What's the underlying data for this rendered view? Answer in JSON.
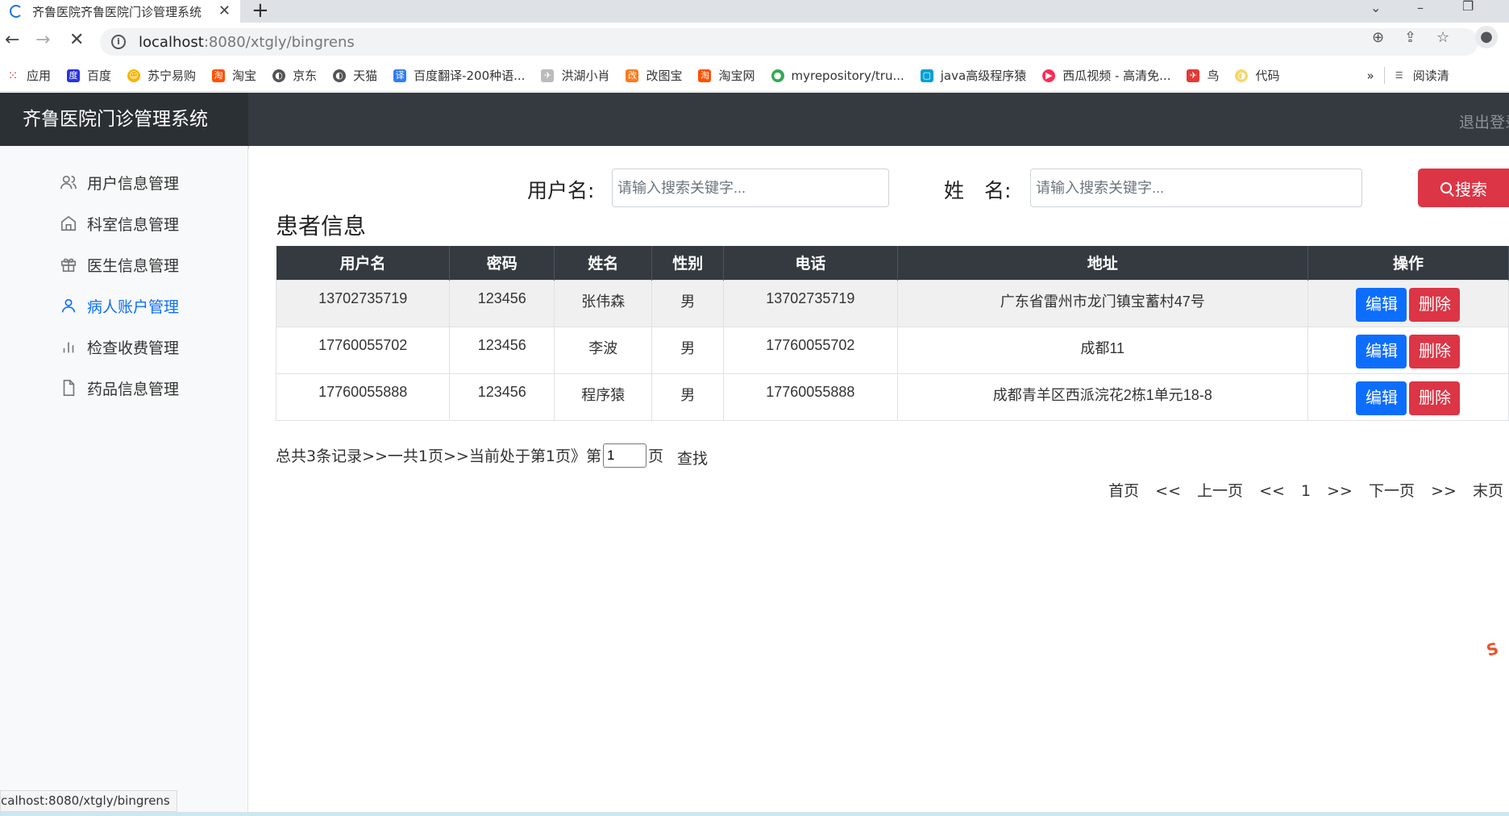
{
  "browser": {
    "tab_title": "齐鲁医院齐鲁医院门诊管理系统",
    "url_host": "localhost",
    "url_rest": ":8080/xtgly/bingrens",
    "status_url": "calhost:8080/xtgly/bingrens",
    "bookmarks": [
      {
        "label": "应用",
        "icon": "apps-grid-icon",
        "color": "#e53935"
      },
      {
        "label": "百度",
        "icon": "baidu-paw-icon",
        "color": "#2932e1"
      },
      {
        "label": "苏宁易购",
        "icon": "suning-icon",
        "color": "#f7b500"
      },
      {
        "label": "淘宝",
        "icon": "taobao-icon",
        "color": "#ff5000"
      },
      {
        "label": "京东",
        "icon": "globe-icon",
        "color": "#555555"
      },
      {
        "label": "天猫",
        "icon": "globe-icon",
        "color": "#555555"
      },
      {
        "label": "百度翻译-200种语...",
        "icon": "baidu-translate-icon",
        "color": "#2f7ef5"
      },
      {
        "label": "洪湖小肖",
        "icon": "bird-icon",
        "color": "#999999"
      },
      {
        "label": "改图宝",
        "icon": "gaitubao-icon",
        "color": "#ff7a1a"
      },
      {
        "label": "淘宝网",
        "icon": "taobao-icon",
        "color": "#ff5000"
      },
      {
        "label": "myrepository/tru...",
        "icon": "chrome-icon",
        "color": "#34a853"
      },
      {
        "label": "java高级程序猿",
        "icon": "bilibili-icon",
        "color": "#00a1d6"
      },
      {
        "label": "西瓜视频 - 高清免...",
        "icon": "xigua-icon",
        "color": "#fe2c55"
      },
      {
        "label": "鸟",
        "icon": "bird-icon",
        "color": "#e53935"
      },
      {
        "label": "代码",
        "icon": "moon-icon",
        "color": "#f5d76e"
      }
    ],
    "reading_list": "阅读清"
  },
  "app": {
    "brand": "齐鲁医院门诊管理系统",
    "logout": "退出登录"
  },
  "sidebar": {
    "items": [
      {
        "label": "用户信息管理",
        "icon": "users-icon",
        "active": false
      },
      {
        "label": "科室信息管理",
        "icon": "home-icon",
        "active": false
      },
      {
        "label": "医生信息管理",
        "icon": "gift-icon",
        "active": false
      },
      {
        "label": "病人账户管理",
        "icon": "person-icon",
        "active": true
      },
      {
        "label": "检查收费管理",
        "icon": "bar-chart-icon",
        "active": false
      },
      {
        "label": "药品信息管理",
        "icon": "file-icon",
        "active": false
      }
    ]
  },
  "search": {
    "username_label": "用户名:",
    "name_label": "姓　名:",
    "placeholder": "请输入搜索关键字...",
    "button": "搜索"
  },
  "table": {
    "title": "患者信息",
    "headers": [
      "用户名",
      "密码",
      "姓名",
      "性别",
      "电话",
      "地址",
      "操作"
    ],
    "rows": [
      {
        "username": "13702735719",
        "password": "123456",
        "name": "张伟森",
        "gender": "男",
        "phone": "13702735719",
        "address": "广东省雷州市龙门镇宝蓄村47号"
      },
      {
        "username": "17760055702",
        "password": "123456",
        "name": "李波",
        "gender": "男",
        "phone": "17760055702",
        "address": "成都11"
      },
      {
        "username": "17760055888",
        "password": "123456",
        "name": "程序猿",
        "gender": "男",
        "phone": "17760055888",
        "address": "成都青羊区西派浣花2栋1单元18-8"
      }
    ],
    "edit_label": "编辑",
    "delete_label": "删除"
  },
  "pagination": {
    "summary": "总共3条记录>>一共1页>>当前处于第1页》第",
    "page_input": "1",
    "page_suffix": "页",
    "find": "查找",
    "first": "首页",
    "prev_sep": "<<",
    "prev": "上一页",
    "prev_sep2": "<<",
    "current": "1",
    "next_sep": ">>",
    "next": "下一页",
    "next_sep2": ">>",
    "last": "末页"
  }
}
